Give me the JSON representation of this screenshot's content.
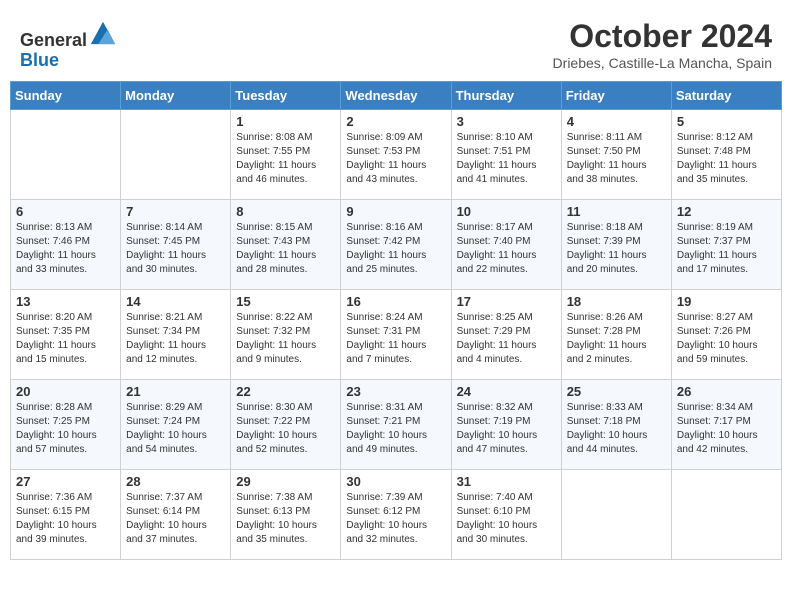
{
  "header": {
    "logo_line1": "General",
    "logo_line2": "Blue",
    "month_title": "October 2024",
    "subtitle": "Driebes, Castille-La Mancha, Spain"
  },
  "weekdays": [
    "Sunday",
    "Monday",
    "Tuesday",
    "Wednesday",
    "Thursday",
    "Friday",
    "Saturday"
  ],
  "weeks": [
    [
      {
        "day": "",
        "info": ""
      },
      {
        "day": "",
        "info": ""
      },
      {
        "day": "1",
        "info": "Sunrise: 8:08 AM\nSunset: 7:55 PM\nDaylight: 11 hours and 46 minutes."
      },
      {
        "day": "2",
        "info": "Sunrise: 8:09 AM\nSunset: 7:53 PM\nDaylight: 11 hours and 43 minutes."
      },
      {
        "day": "3",
        "info": "Sunrise: 8:10 AM\nSunset: 7:51 PM\nDaylight: 11 hours and 41 minutes."
      },
      {
        "day": "4",
        "info": "Sunrise: 8:11 AM\nSunset: 7:50 PM\nDaylight: 11 hours and 38 minutes."
      },
      {
        "day": "5",
        "info": "Sunrise: 8:12 AM\nSunset: 7:48 PM\nDaylight: 11 hours and 35 minutes."
      }
    ],
    [
      {
        "day": "6",
        "info": "Sunrise: 8:13 AM\nSunset: 7:46 PM\nDaylight: 11 hours and 33 minutes."
      },
      {
        "day": "7",
        "info": "Sunrise: 8:14 AM\nSunset: 7:45 PM\nDaylight: 11 hours and 30 minutes."
      },
      {
        "day": "8",
        "info": "Sunrise: 8:15 AM\nSunset: 7:43 PM\nDaylight: 11 hours and 28 minutes."
      },
      {
        "day": "9",
        "info": "Sunrise: 8:16 AM\nSunset: 7:42 PM\nDaylight: 11 hours and 25 minutes."
      },
      {
        "day": "10",
        "info": "Sunrise: 8:17 AM\nSunset: 7:40 PM\nDaylight: 11 hours and 22 minutes."
      },
      {
        "day": "11",
        "info": "Sunrise: 8:18 AM\nSunset: 7:39 PM\nDaylight: 11 hours and 20 minutes."
      },
      {
        "day": "12",
        "info": "Sunrise: 8:19 AM\nSunset: 7:37 PM\nDaylight: 11 hours and 17 minutes."
      }
    ],
    [
      {
        "day": "13",
        "info": "Sunrise: 8:20 AM\nSunset: 7:35 PM\nDaylight: 11 hours and 15 minutes."
      },
      {
        "day": "14",
        "info": "Sunrise: 8:21 AM\nSunset: 7:34 PM\nDaylight: 11 hours and 12 minutes."
      },
      {
        "day": "15",
        "info": "Sunrise: 8:22 AM\nSunset: 7:32 PM\nDaylight: 11 hours and 9 minutes."
      },
      {
        "day": "16",
        "info": "Sunrise: 8:24 AM\nSunset: 7:31 PM\nDaylight: 11 hours and 7 minutes."
      },
      {
        "day": "17",
        "info": "Sunrise: 8:25 AM\nSunset: 7:29 PM\nDaylight: 11 hours and 4 minutes."
      },
      {
        "day": "18",
        "info": "Sunrise: 8:26 AM\nSunset: 7:28 PM\nDaylight: 11 hours and 2 minutes."
      },
      {
        "day": "19",
        "info": "Sunrise: 8:27 AM\nSunset: 7:26 PM\nDaylight: 10 hours and 59 minutes."
      }
    ],
    [
      {
        "day": "20",
        "info": "Sunrise: 8:28 AM\nSunset: 7:25 PM\nDaylight: 10 hours and 57 minutes."
      },
      {
        "day": "21",
        "info": "Sunrise: 8:29 AM\nSunset: 7:24 PM\nDaylight: 10 hours and 54 minutes."
      },
      {
        "day": "22",
        "info": "Sunrise: 8:30 AM\nSunset: 7:22 PM\nDaylight: 10 hours and 52 minutes."
      },
      {
        "day": "23",
        "info": "Sunrise: 8:31 AM\nSunset: 7:21 PM\nDaylight: 10 hours and 49 minutes."
      },
      {
        "day": "24",
        "info": "Sunrise: 8:32 AM\nSunset: 7:19 PM\nDaylight: 10 hours and 47 minutes."
      },
      {
        "day": "25",
        "info": "Sunrise: 8:33 AM\nSunset: 7:18 PM\nDaylight: 10 hours and 44 minutes."
      },
      {
        "day": "26",
        "info": "Sunrise: 8:34 AM\nSunset: 7:17 PM\nDaylight: 10 hours and 42 minutes."
      }
    ],
    [
      {
        "day": "27",
        "info": "Sunrise: 7:36 AM\nSunset: 6:15 PM\nDaylight: 10 hours and 39 minutes."
      },
      {
        "day": "28",
        "info": "Sunrise: 7:37 AM\nSunset: 6:14 PM\nDaylight: 10 hours and 37 minutes."
      },
      {
        "day": "29",
        "info": "Sunrise: 7:38 AM\nSunset: 6:13 PM\nDaylight: 10 hours and 35 minutes."
      },
      {
        "day": "30",
        "info": "Sunrise: 7:39 AM\nSunset: 6:12 PM\nDaylight: 10 hours and 32 minutes."
      },
      {
        "day": "31",
        "info": "Sunrise: 7:40 AM\nSunset: 6:10 PM\nDaylight: 10 hours and 30 minutes."
      },
      {
        "day": "",
        "info": ""
      },
      {
        "day": "",
        "info": ""
      }
    ]
  ]
}
